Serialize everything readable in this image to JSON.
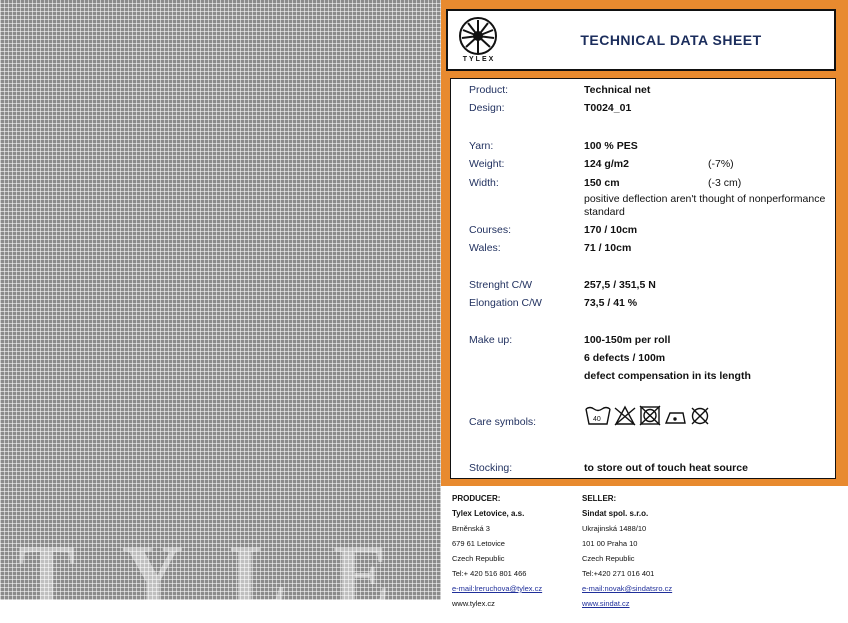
{
  "title": "TECHNICAL DATA SHEET",
  "logo_text": "TYLEX",
  "watermark": "TYLEX",
  "rows": [
    {
      "label": "Product:",
      "value": "Technical net"
    },
    {
      "label": "Design:",
      "value": "T0024_01"
    },
    {
      "label": "Yarn:",
      "value": "100 % PES"
    },
    {
      "label": "Weight:",
      "value": "124 g/m2",
      "note": "(-7%)"
    },
    {
      "label": "Width:",
      "value": "150 cm",
      "note": "(-3 cm)"
    },
    {
      "label": "Courses:",
      "value": "170 / 10cm"
    },
    {
      "label": "Wales:",
      "value": "71 / 10cm"
    },
    {
      "label": "Strenght C/W",
      "value": "257,5 / 351,5 N"
    },
    {
      "label": "Elongation C/W",
      "value": "73,5 / 41 %"
    },
    {
      "label": "Make up:",
      "value": "100-150m per roll"
    },
    {
      "label": "Care symbols:"
    },
    {
      "label": "Stocking:",
      "value": "to store out of touch heat source"
    }
  ],
  "deflection_note": "positive deflection aren't thought of nonperformance standard",
  "makeup_extra": [
    "6 defects / 100m",
    "defect compensation in its length"
  ],
  "care_wash_temp": "40",
  "producer": {
    "heading": "PRODUCER:",
    "name": "Tylex Letovice, a.s.",
    "street": "Brněnská 3",
    "city": "679 61 Letovice",
    "country": "Czech Republic",
    "tel": "Tel:+ 420 516 801 466",
    "email": "e-mail:lreruchova@tylex.cz",
    "web": "www.tylex.cz"
  },
  "seller": {
    "heading": "SELLER:",
    "name": "Sindat spol. s.r.o.",
    "street": "Ukrajinská 1488/10",
    "city": "101 00 Praha 10",
    "country": "Czech Republic",
    "tel": "Tel:+420 271 016 401",
    "email": "e-mail:novak@sindatsro.cz",
    "web": "www.sindat.cz"
  },
  "colors": {
    "frame": "#e88a2f",
    "title": "#1b2d5c",
    "label": "#1f2f5e"
  }
}
